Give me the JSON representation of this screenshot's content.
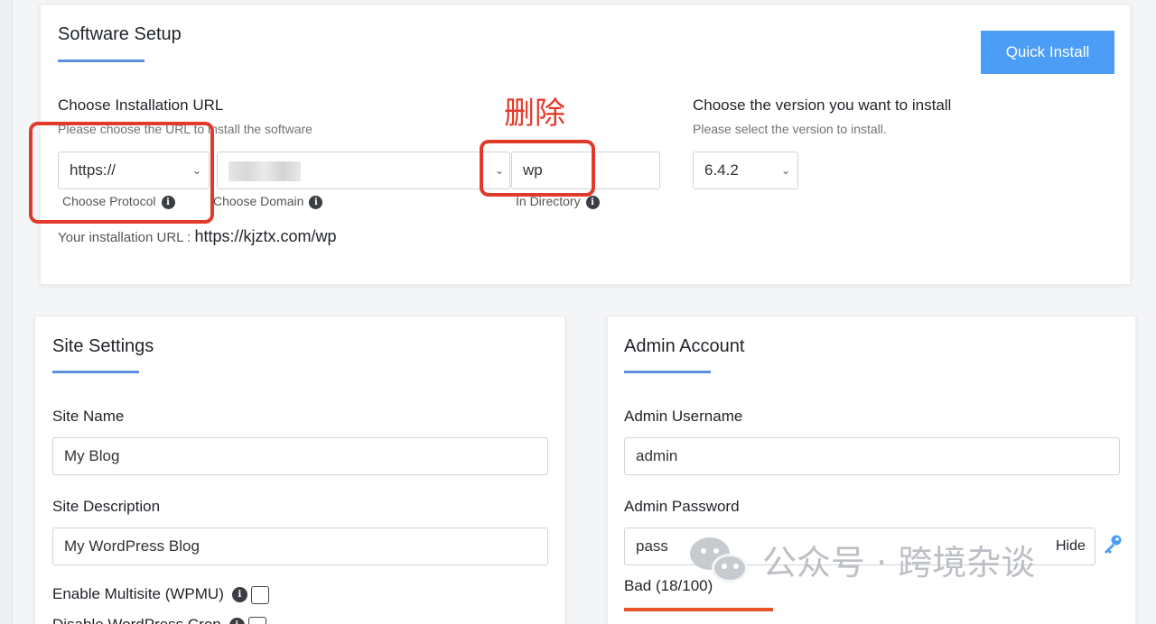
{
  "setup": {
    "title": "Software Setup",
    "quick_install": "Quick Install",
    "install_url_title": "Choose Installation URL",
    "install_url_hint": "Please choose the URL to install the software",
    "protocol_value": "https://",
    "protocol_label": "Choose Protocol",
    "domain_label": "Choose Domain",
    "directory_value": "wp",
    "directory_label": "In Directory",
    "your_url_label": "Your installation URL :",
    "your_url_value": "https://kjztx.com/wp",
    "version_title": "Choose the version you want to install",
    "version_hint": "Please select the version to install.",
    "version_value": "6.4.2"
  },
  "annotation": {
    "delete_text": "删除",
    "color": "#e23a2a"
  },
  "site_settings": {
    "title": "Site Settings",
    "site_name_label": "Site Name",
    "site_name_value": "My Blog",
    "site_desc_label": "Site Description",
    "site_desc_value": "My WordPress Blog",
    "multisite_label": "Enable Multisite (WPMU)",
    "disable_cron_label": "Disable WordPress Cron"
  },
  "admin_account": {
    "title": "Admin Account",
    "username_label": "Admin Username",
    "username_value": "admin",
    "password_label": "Admin Password",
    "password_value": "pass",
    "hide_label": "Hide",
    "strength_label": "Bad (18/100)",
    "strength_percent": 30,
    "strength_color": "#e8542a"
  },
  "watermark": {
    "text": "公众号 · 跨境杂谈"
  },
  "colors": {
    "accent": "#4c9df5",
    "underline": "#5b8fe0"
  }
}
